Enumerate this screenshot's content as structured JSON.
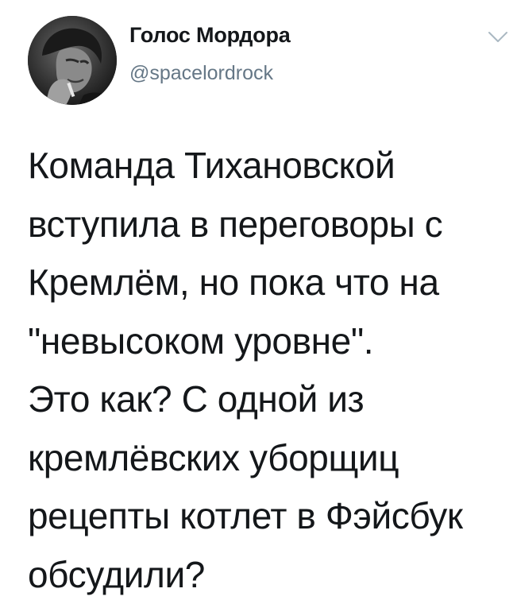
{
  "author": {
    "display_name": "Голос Мордора",
    "handle": "@spacelordrock",
    "avatar_icon": "profile-photo"
  },
  "menu": {
    "icon": "chevron-down-icon"
  },
  "tweet": {
    "lines": [
      "Команда Тихановской",
      "вступила в переговоры с",
      "Кремлём, но пока что на",
      "\"невысоком уровне\".",
      "Это как? С одной из",
      "кремлёвских уборщиц",
      "рецепты котлет в Фэйсбук",
      "обсудили?"
    ]
  },
  "colors": {
    "text": "#14171a",
    "secondary": "#657786",
    "background": "#ffffff"
  }
}
